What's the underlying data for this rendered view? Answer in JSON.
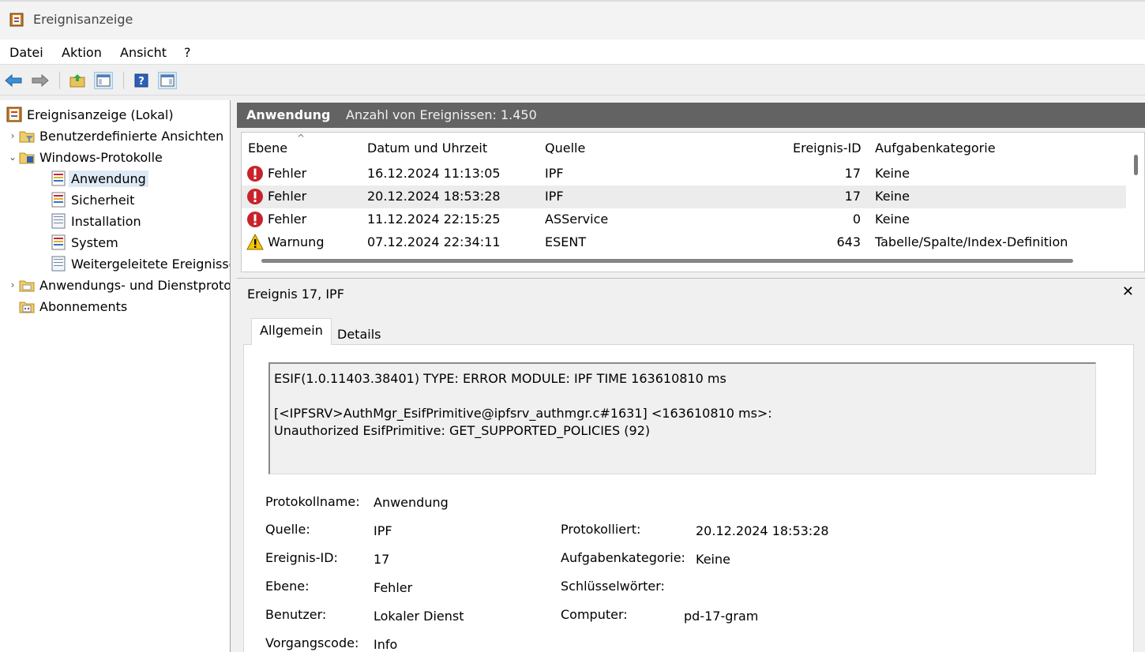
{
  "window": {
    "title": "Ereignisanzeige",
    "icon": "event-viewer-icon"
  },
  "menu": {
    "file": "Datei",
    "action": "Aktion",
    "view": "Ansicht",
    "help": "?"
  },
  "toolbar": {
    "back": "back-arrow-icon",
    "forward": "forward-arrow-icon",
    "up": "up-folder-icon",
    "show_hide_tree": "console-tree-icon",
    "help": "help-icon",
    "show_hide_action": "action-pane-icon"
  },
  "tree": {
    "root": "Ereignisanzeige (Lokal)",
    "custom_views": "Benutzerdefinierte Ansichten",
    "windows_logs": "Windows-Protokolle",
    "logs": [
      "Anwendung",
      "Sicherheit",
      "Installation",
      "System",
      "Weitergeleitete Ereignisse"
    ],
    "app_service_logs": "Anwendungs- und Dienstprotokolle",
    "subscriptions": "Abonnements"
  },
  "log_header": {
    "name": "Anwendung",
    "count": "Anzahl von Ereignissen: 1.450"
  },
  "columns": {
    "level": "Ebene",
    "datetime": "Datum und Uhrzeit",
    "source": "Quelle",
    "event_id": "Ereignis-ID",
    "task_category": "Aufgabenkategorie"
  },
  "events": [
    {
      "level": "Fehler",
      "level_icon": "error-icon",
      "datetime": "16.12.2024 11:13:05",
      "source": "IPF",
      "event_id": "17",
      "task_category": "Keine"
    },
    {
      "level": "Fehler",
      "level_icon": "error-icon",
      "datetime": "20.12.2024 18:53:28",
      "source": "IPF",
      "event_id": "17",
      "task_category": "Keine"
    },
    {
      "level": "Fehler",
      "level_icon": "error-icon",
      "datetime": "11.12.2024 22:15:25",
      "source": "ASService",
      "event_id": "0",
      "task_category": "Keine"
    },
    {
      "level": "Warnung",
      "level_icon": "warning-icon",
      "datetime": "07.12.2024 22:34:11",
      "source": "ESENT",
      "event_id": "643",
      "task_category": "Tabelle/Spalte/Index-Definition"
    }
  ],
  "detail": {
    "title": "Ereignis 17, IPF",
    "close": "✕",
    "tabs": {
      "general": "Allgemein",
      "details": "Details"
    },
    "message": {
      "line1": "ESIF(1.0.11403.38401) TYPE: ERROR MODULE: IPF TIME 163610810 ms",
      "line2": "[<IPFSRV>AuthMgr_EsifPrimitive@ipfsrv_authmgr.c#1631] <163610810 ms>:",
      "line3": "Unauthorized EsifPrimitive: GET_SUPPORTED_POLICIES (92)"
    },
    "props": {
      "log_name_label": "Protokollname:",
      "log_name": "Anwendung",
      "source_label": "Quelle:",
      "source": "IPF",
      "logged_label": "Protokolliert:",
      "logged": "20.12.2024 18:53:28",
      "event_id_label": "Ereignis-ID:",
      "event_id": "17",
      "task_label": "Aufgabenkategorie:",
      "task": "Keine",
      "level_label": "Ebene:",
      "level": "Fehler",
      "keywords_label": "Schlüsselwörter:",
      "user_label": "Benutzer:",
      "user": "Lokaler Dienst",
      "computer_label": "Computer:",
      "computer": "pd-17-gram",
      "opcode_label": "Vorgangscode:",
      "opcode": "Info"
    }
  }
}
